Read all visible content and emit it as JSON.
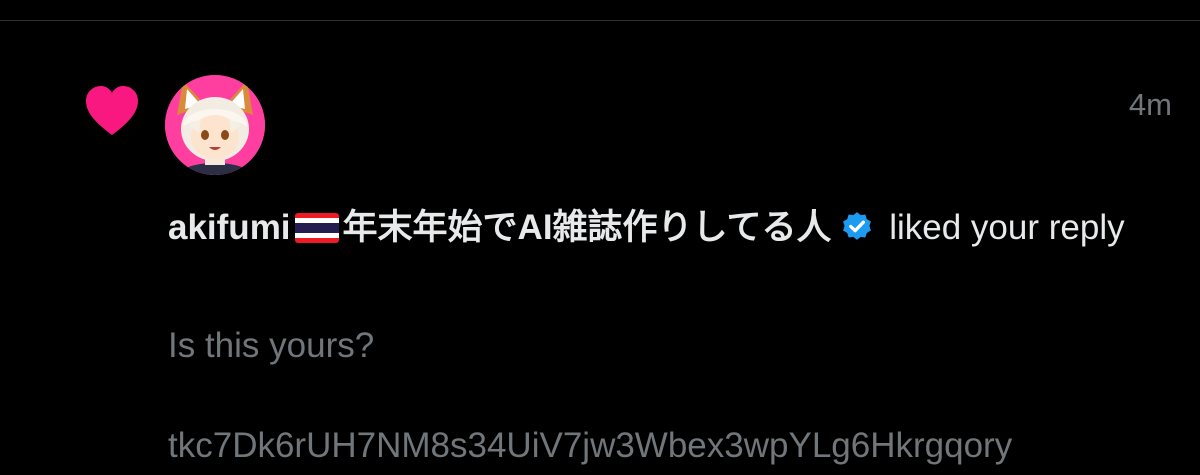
{
  "notification": {
    "type_icon": "heart-icon",
    "timestamp": "4m",
    "user": {
      "display_name": "akifumi",
      "flag_icon": "thailand-flag-icon",
      "display_name_suffix": "年末年始でAI雑誌作りしてる人",
      "verified_icon": "verified-badge-icon"
    },
    "action_text": " liked your reply",
    "tweet_text": "Is this yours?\n\ntkc7Dk6rUH7NM8s34UiV7jw3Wbex3wpYLg6Hkrgqory"
  },
  "colors": {
    "background": "#000000",
    "heart": "#f91880",
    "primary_text": "#e7e9ea",
    "secondary_text": "#71767b",
    "verified": "#1d9bf0",
    "avatar_background": "#ff3fa0",
    "divider": "#2f3336"
  }
}
